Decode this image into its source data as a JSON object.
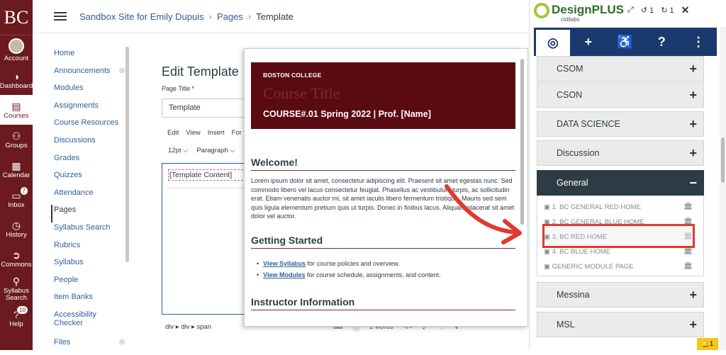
{
  "global_nav": {
    "logo": "BC",
    "items": [
      {
        "label": "Account",
        "icon": "avatar-icon"
      },
      {
        "label": "Dashboard",
        "icon": "dashboard-icon"
      },
      {
        "label": "Courses",
        "icon": "book-icon"
      },
      {
        "label": "Groups",
        "icon": "groups-icon"
      },
      {
        "label": "Calendar",
        "icon": "calendar-icon"
      },
      {
        "label": "Inbox",
        "icon": "inbox-icon",
        "badge": "7"
      },
      {
        "label": "History",
        "icon": "clock-icon"
      },
      {
        "label": "Commons",
        "icon": "commons-icon"
      },
      {
        "label": "Syllabus Search",
        "icon": "search-icon"
      },
      {
        "label": "Help",
        "icon": "help-icon",
        "badge": "10"
      }
    ]
  },
  "breadcrumb": {
    "site": "Sandbox Site for Emily Dupuis",
    "section": "Pages",
    "current": "Template",
    "sep": "›"
  },
  "course_nav": {
    "items": [
      "Home",
      "Announcements",
      "Modules",
      "Assignments",
      "Course Resources",
      "Discussions",
      "Grades",
      "Quizzes",
      "Attendance",
      "Pages",
      "Syllabus Search",
      "Rubrics",
      "Syllabus",
      "People",
      "Item Banks",
      "Accessibility Checker",
      "Files"
    ],
    "active": "Pages"
  },
  "editor": {
    "heading": "Edit Template",
    "title_label": "Page Title *",
    "title_value": "Template",
    "menu": [
      "Edit",
      "View",
      "Insert",
      "For"
    ],
    "font_size": "12pt ⌵",
    "paragraph": "Paragraph ⌵",
    "content": "[Template Content]",
    "path": "div ▸ div ▸ span",
    "word_count": "2 words",
    "bottom_icons": [
      "⌨",
      "ⓘ",
      "2 words",
      "</>",
      "⤢",
      "⋮",
      "↙"
    ]
  },
  "preview": {
    "banner_small": "BOSTON COLLEGE",
    "banner_ghost": "Course Title",
    "banner_course": "COURSE#.01 Spring 2022 | Prof. [Name]",
    "welcome_title": "Welcome!",
    "welcome_text": "Lorem ipsum dolor sit amet, consectetur adipiscing elit. Praesent sit amet egestas nunc. Sed commodo libero vel lacus consectetur feugiat. Phasellus ac vestibulum turpis, ac sollicitudin erat. Etiam venenatis auctor mi, sit amet iaculis libero fermentum tristique. Mauris sed sem quis ligula elementum pretium quis ut turpis. Donec in finibus lacus. Aliquam placerat sit amet dolor vel auctor.",
    "getting_started_title": "Getting Started",
    "bullets": [
      {
        "link": "View Syllabus",
        "text": " for course policies and overview."
      },
      {
        "link": "View Modules",
        "text": " for course schedule, assignments, and content."
      }
    ],
    "instructor_title": "Instructor Information"
  },
  "designplus": {
    "brand": "DesignPLUS",
    "sub": "cidilabs",
    "undo_count": "1",
    "redo_count": "1",
    "close": "✕",
    "tabs": [
      "◎",
      "+",
      "♿",
      "?",
      "⋮"
    ],
    "categories_top": [
      "CSOM",
      "CSON",
      "DATA SCIENCE",
      "Discussion"
    ],
    "open_category": "General",
    "templates": [
      "1. BC GENERAL RED HOME",
      "2. BC GENERAL BLUE HOME",
      "3. BC RED HOME",
      "4. BC BLUE HOME",
      "GENERIC MODULE PAGE"
    ],
    "highlighted_template": "3. BC RED HOME",
    "categories_bottom": [
      "Messina",
      "MSL"
    ],
    "alert": "🔔1"
  }
}
